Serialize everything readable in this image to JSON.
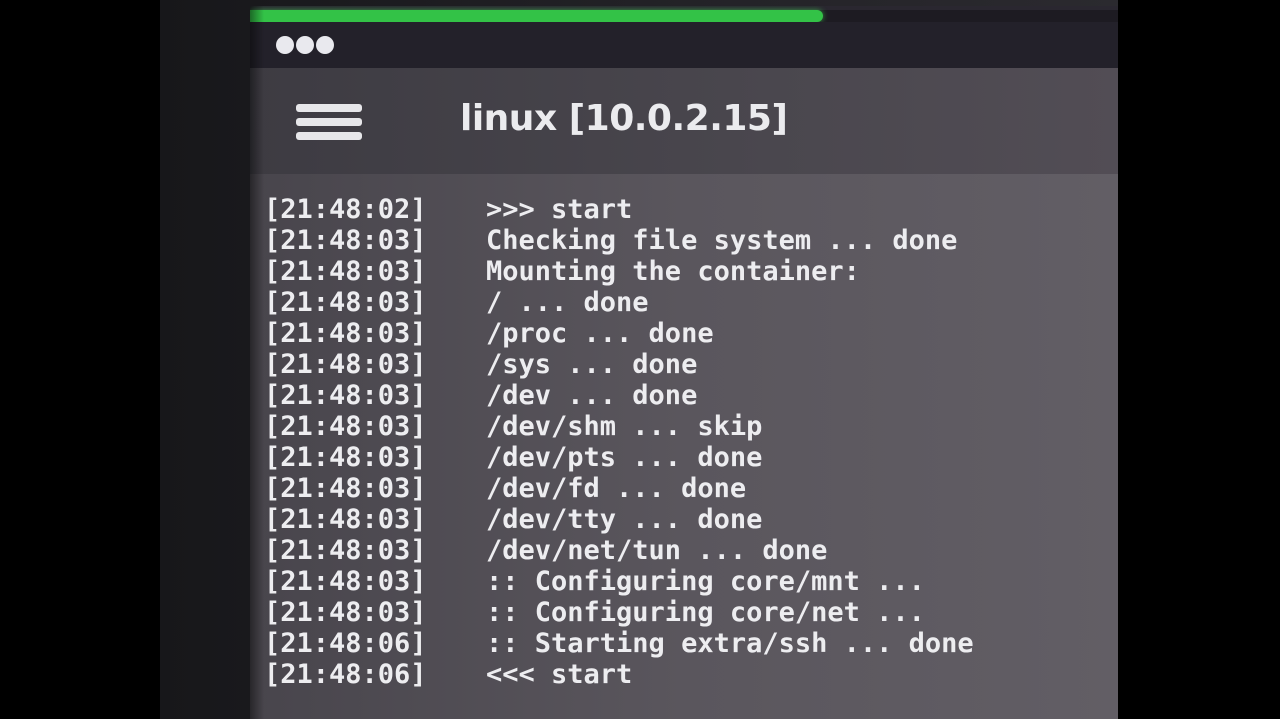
{
  "status_bar": {
    "load_progress": 0.66,
    "notification_dot_count": 3
  },
  "app_bar": {
    "menu_icon": "hamburger-menu-icon",
    "title": "linux [10.0.2.15]"
  },
  "terminal": {
    "lines": [
      {
        "timestamp": "[21:48:02]",
        "message": ">>> start"
      },
      {
        "timestamp": "[21:48:03]",
        "message": "Checking file system ... done"
      },
      {
        "timestamp": "[21:48:03]",
        "message": "Mounting the container:"
      },
      {
        "timestamp": "[21:48:03]",
        "message": "/ ... done"
      },
      {
        "timestamp": "[21:48:03]",
        "message": "/proc ... done"
      },
      {
        "timestamp": "[21:48:03]",
        "message": "/sys ... done"
      },
      {
        "timestamp": "[21:48:03]",
        "message": "/dev ... done"
      },
      {
        "timestamp": "[21:48:03]",
        "message": "/dev/shm ... skip"
      },
      {
        "timestamp": "[21:48:03]",
        "message": "/dev/pts ... done"
      },
      {
        "timestamp": "[21:48:03]",
        "message": "/dev/fd ... done"
      },
      {
        "timestamp": "[21:48:03]",
        "message": "/dev/tty ... done"
      },
      {
        "timestamp": "[21:48:03]",
        "message": "/dev/net/tun ... done"
      },
      {
        "timestamp": "[21:48:03]",
        "message": ":: Configuring core/mnt ..."
      },
      {
        "timestamp": "[21:48:03]",
        "message": ":: Configuring core/net ..."
      },
      {
        "timestamp": "[21:48:06]",
        "message": ":: Starting extra/ssh ... done"
      },
      {
        "timestamp": "[21:48:06]",
        "message": "<<< start"
      }
    ]
  },
  "colors": {
    "progress": "#33c247",
    "terminal_text": "#ededf0",
    "app_bar": "#46434a",
    "terminal_bg": "#56525a"
  }
}
